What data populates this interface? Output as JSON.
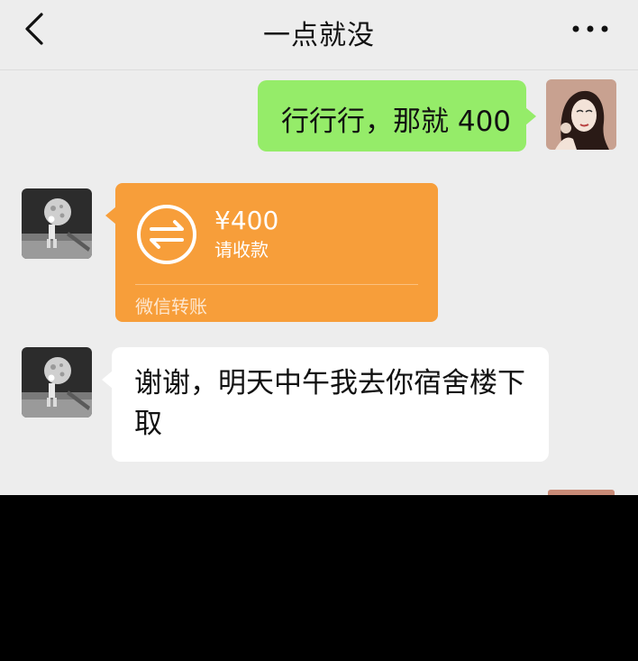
{
  "header": {
    "title": "一点就没",
    "back_icon": "chevron-left-icon",
    "more_icon": "more-dots-icon"
  },
  "messages": [
    {
      "side": "right",
      "type": "text",
      "text": "行行行，那就 400",
      "bubble_color": "#95ec69"
    },
    {
      "side": "left",
      "type": "transfer",
      "amount": "¥400",
      "status": "请收款",
      "footer": "微信转账",
      "bubble_color": "#f79e3a",
      "icon": "transfer-arrows-icon"
    },
    {
      "side": "left",
      "type": "text",
      "text": "谢谢，明天中午我去你宿舍楼下取",
      "bubble_color": "#ffffff"
    }
  ],
  "colors": {
    "chat_background": "#ededed",
    "outgoing_bubble": "#95ec69",
    "transfer_card": "#f79e3a",
    "incoming_bubble": "#ffffff"
  }
}
